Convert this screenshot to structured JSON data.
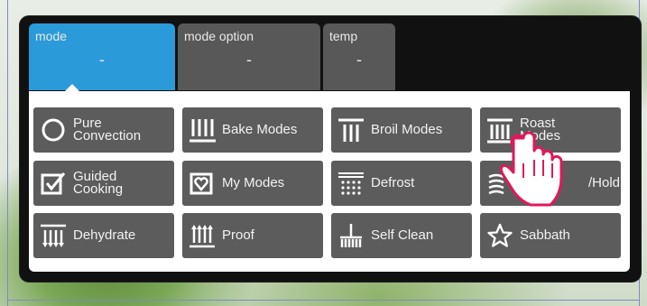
{
  "tabs": {
    "mode": {
      "label": "mode",
      "value": "-"
    },
    "mode_option": {
      "label": "mode option",
      "value": "-"
    },
    "temp": {
      "label": "temp",
      "value": "-"
    }
  },
  "modes": [
    {
      "label": "Pure\nConvection",
      "icon": "circle-icon"
    },
    {
      "label": "Bake Modes",
      "icon": "bake-icon"
    },
    {
      "label": "Broil Modes",
      "icon": "broil-icon"
    },
    {
      "label": "Roast\nModes",
      "icon": "roast-icon"
    },
    {
      "label": "Guided\nCooking",
      "icon": "checkbox-icon"
    },
    {
      "label": "My Modes",
      "icon": "heart-icon"
    },
    {
      "label": "Defrost",
      "icon": "defrost-icon"
    },
    {
      "label": "/Hold",
      "icon": "warm-icon"
    },
    {
      "label": "Dehydrate",
      "icon": "dehydrate-icon"
    },
    {
      "label": "Proof",
      "icon": "proof-icon"
    },
    {
      "label": "Self Clean",
      "icon": "broom-icon"
    },
    {
      "label": "Sabbath",
      "icon": "star-icon"
    }
  ],
  "colors": {
    "selected_tab": "#2b9ad8",
    "tile": "#5c5c5c",
    "touch_indicator": "#e0185e"
  }
}
